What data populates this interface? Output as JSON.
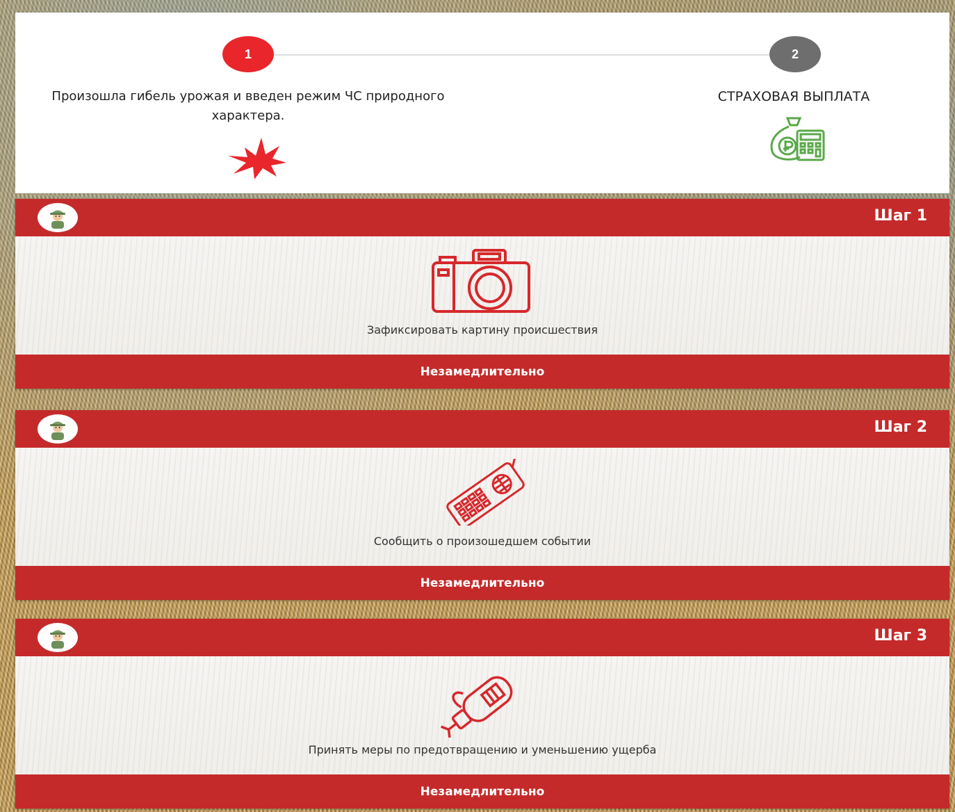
{
  "progress": {
    "stages": [
      {
        "number": "1",
        "text": "Произошла гибель урожая и введен режим ЧС природного характера.",
        "icon": "explosion-icon",
        "color": "#e8262b"
      },
      {
        "number": "2",
        "text": "СТРАХОВАЯ ВЫПЛАТА",
        "icon": "money-bag-calculator-icon",
        "color": "#6e6e6e"
      }
    ]
  },
  "steps": [
    {
      "title": "Шаг 1",
      "icon": "camera-icon",
      "text": "Зафиксировать картину происшествия",
      "footer": "Незамедлительно"
    },
    {
      "title": "Шаг 2",
      "icon": "radio-phone-icon",
      "text": "Сообщить о произошедшем событии",
      "footer": "Незамедлительно"
    },
    {
      "title": "Шаг 3",
      "icon": "fire-extinguisher-icon",
      "text": "Принять меры по предотвращению и уменьшению ущерба",
      "footer": "Незамедлительно"
    }
  ],
  "colors": {
    "accent": "#c42a2a",
    "step1_circle": "#e8262b",
    "step2_circle": "#6e6e6e",
    "icon_green": "#5aa84a"
  }
}
